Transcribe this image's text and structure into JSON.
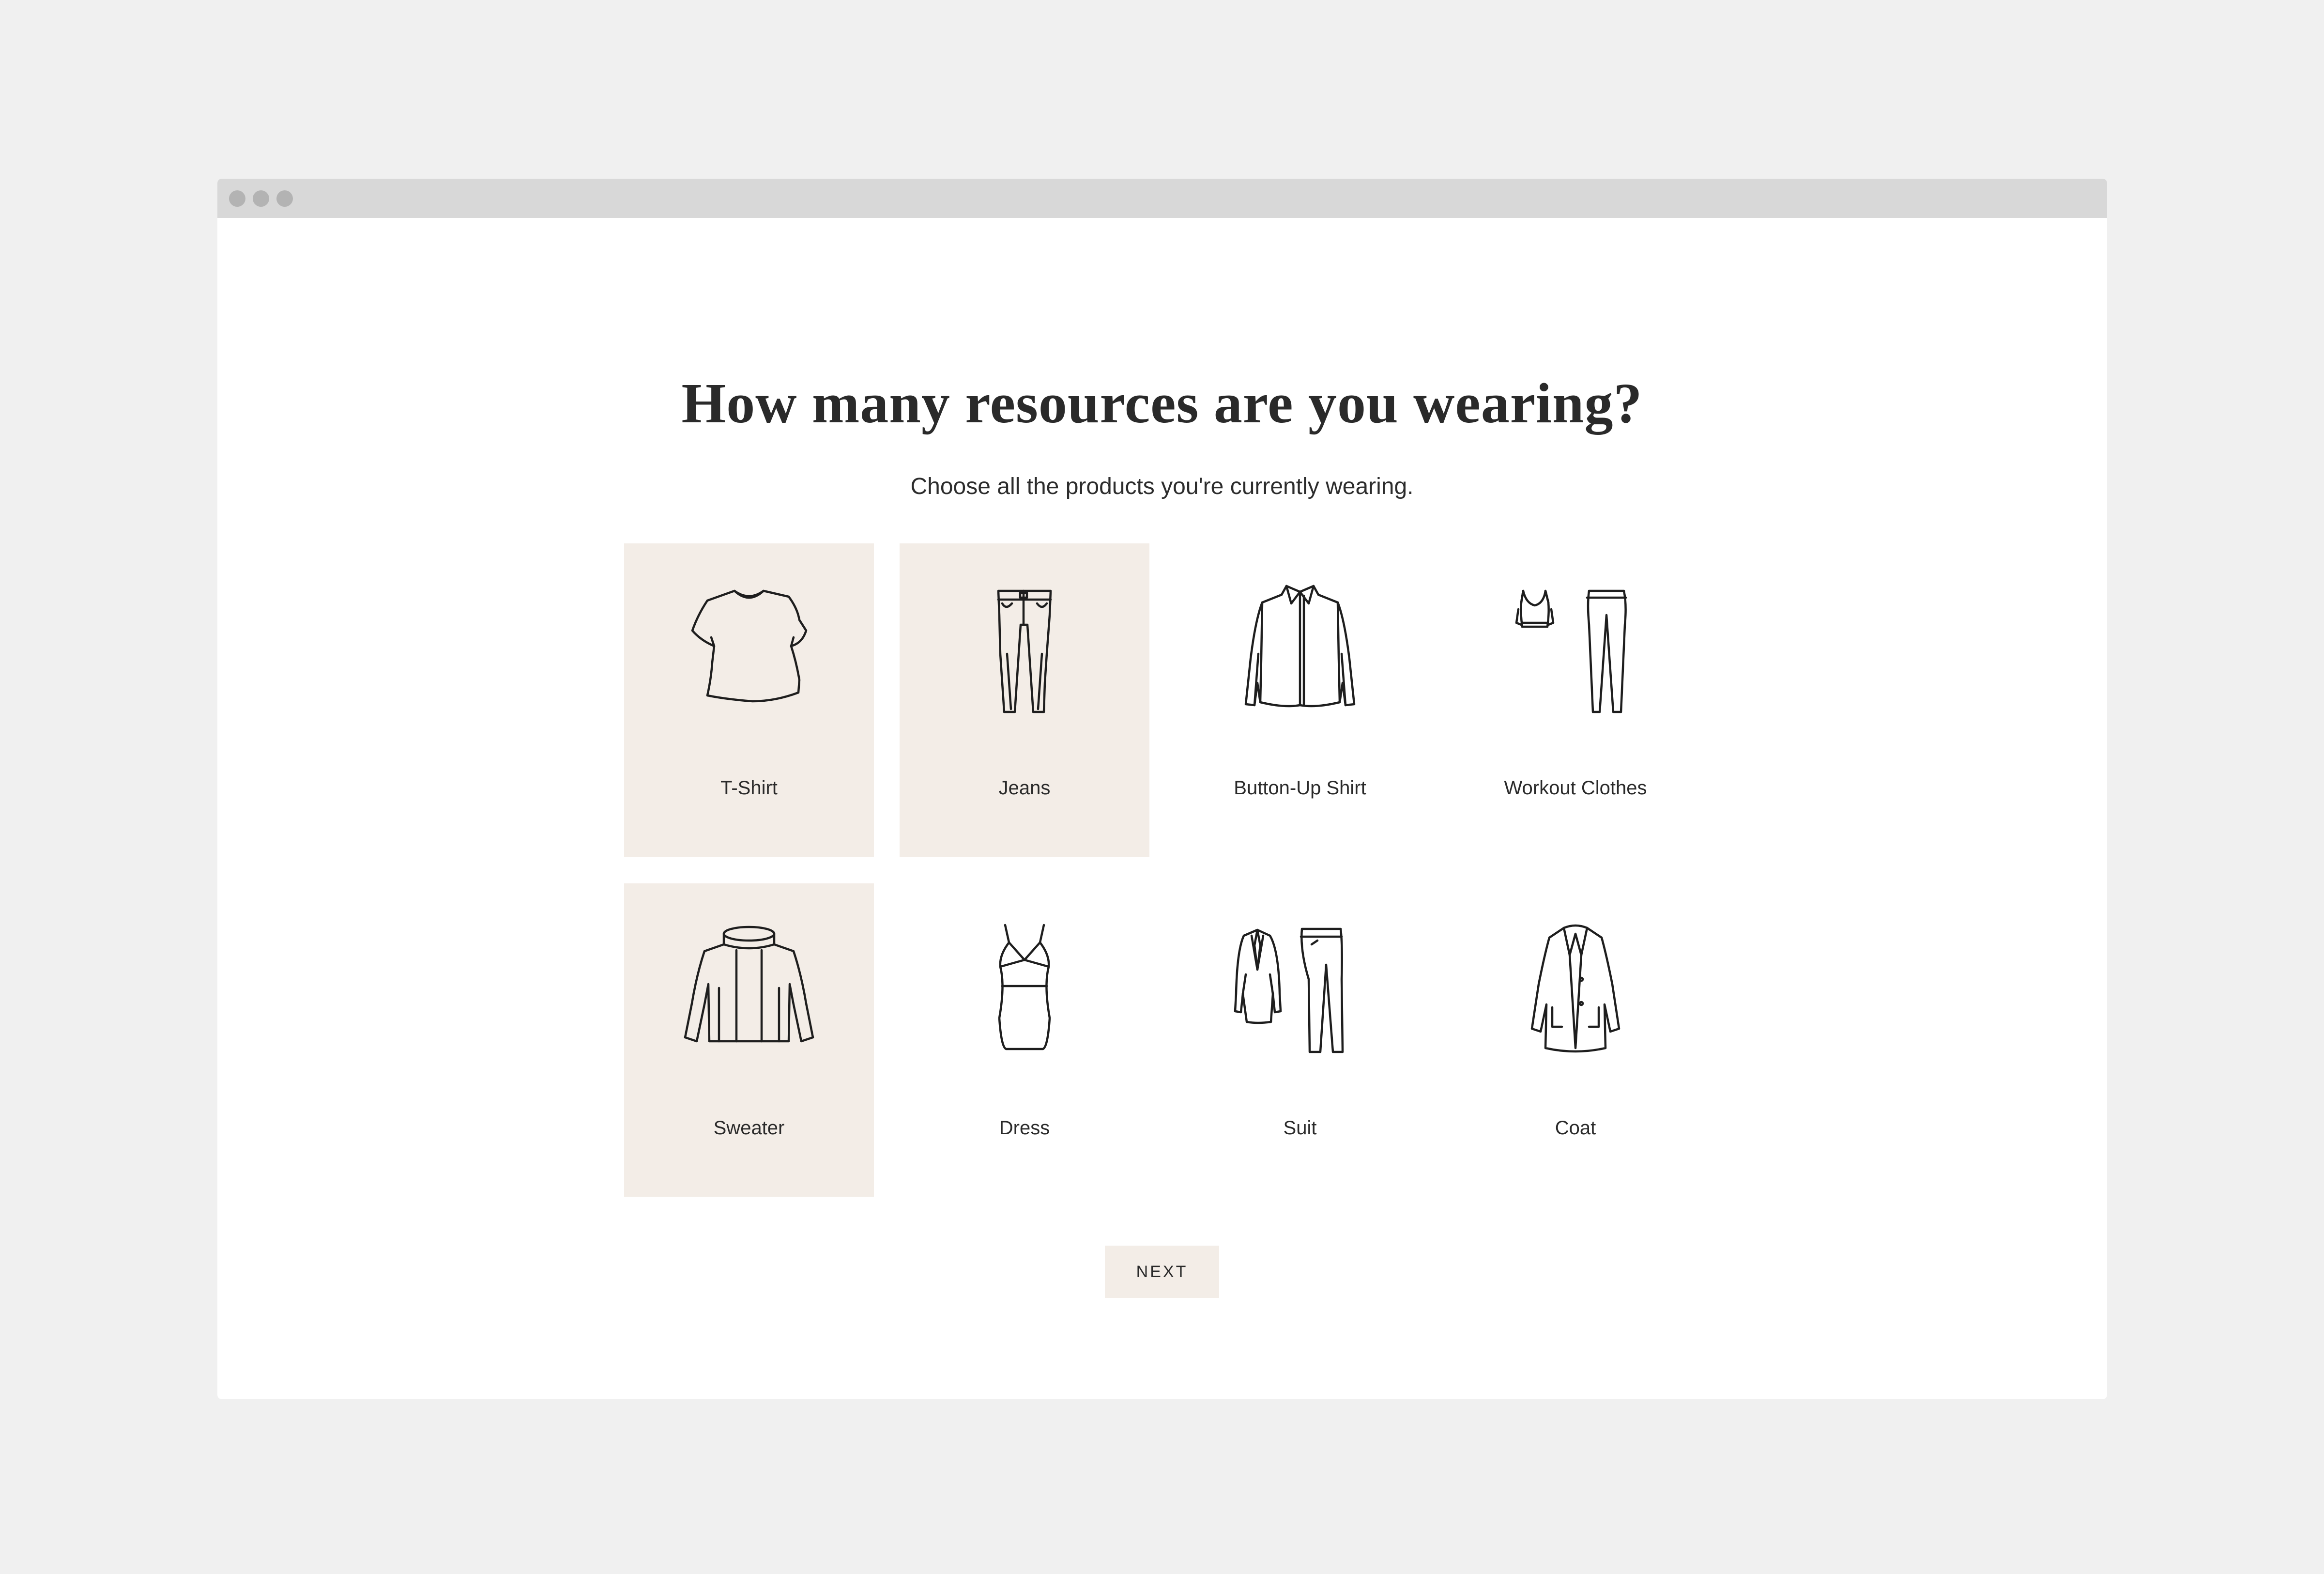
{
  "window": {
    "controls": [
      "close-dot",
      "minimize-dot",
      "zoom-dot"
    ]
  },
  "header": {
    "title": "How many resources are you wearing?",
    "subtitle": "Choose all the products you're currently wearing."
  },
  "products": [
    {
      "label": "T-Shirt",
      "icon": "tshirt-icon",
      "selected": true
    },
    {
      "label": "Jeans",
      "icon": "jeans-icon",
      "selected": true
    },
    {
      "label": "Button-Up Shirt",
      "icon": "button-up-shirt-icon",
      "selected": false
    },
    {
      "label": "Workout Clothes",
      "icon": "workout-clothes-icon",
      "selected": false
    },
    {
      "label": "Sweater",
      "icon": "sweater-icon",
      "selected": true
    },
    {
      "label": "Dress",
      "icon": "dress-icon",
      "selected": false
    },
    {
      "label": "Suit",
      "icon": "suit-icon",
      "selected": false
    },
    {
      "label": "Coat",
      "icon": "coat-icon",
      "selected": false
    }
  ],
  "actions": {
    "next_label": "NEXT"
  },
  "colors": {
    "page_background": "#f0f0f0",
    "window_background": "#ffffff",
    "title_bar": "#d8d8d8",
    "selected_tile": "#f3ede7",
    "button_background": "#f3ede7",
    "text": "#2a2a2a"
  }
}
